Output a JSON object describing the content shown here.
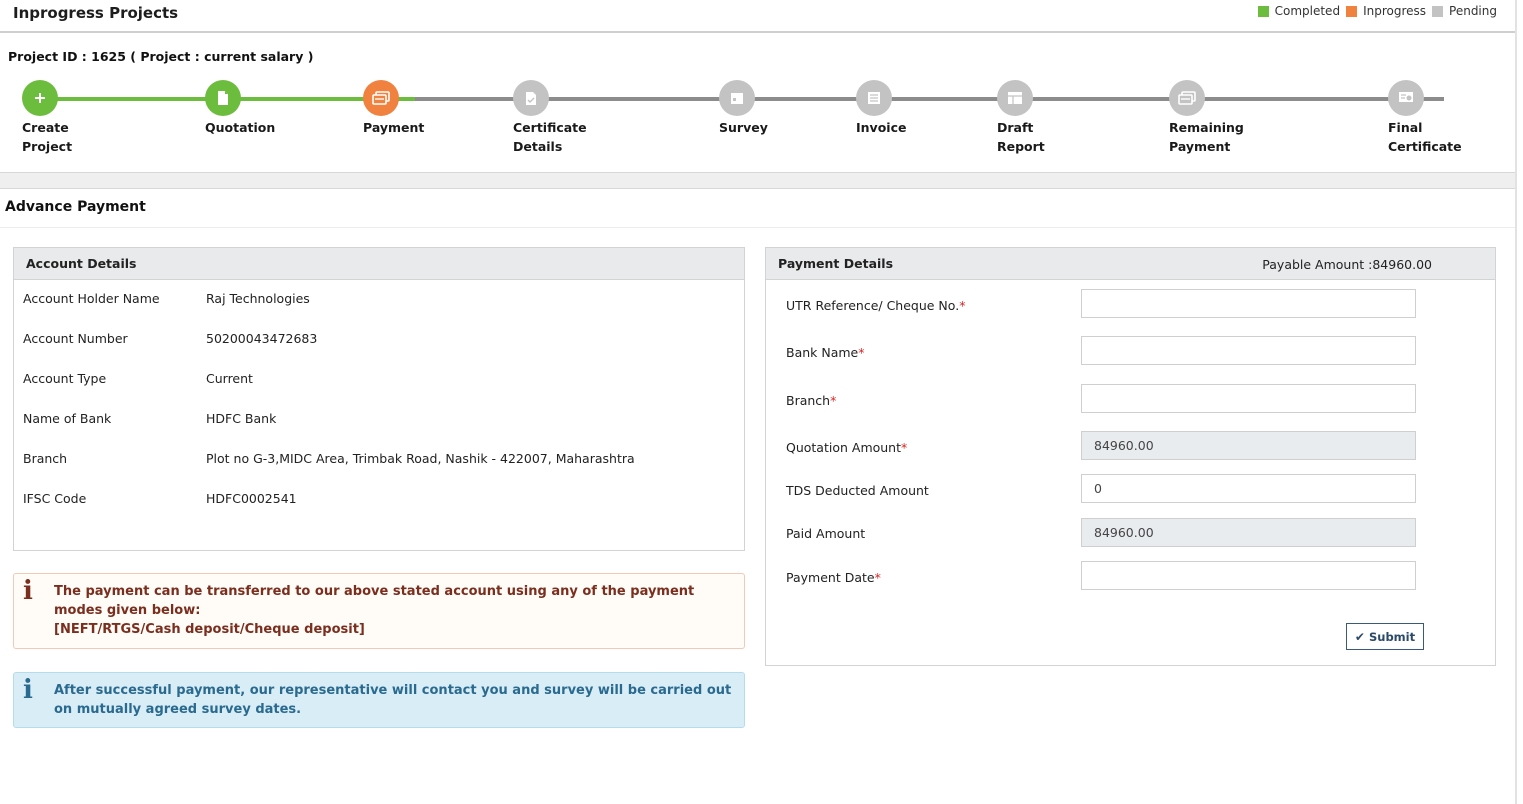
{
  "header": {
    "title": "Inprogress Projects"
  },
  "legend": [
    {
      "label": "Completed",
      "color": "#6cbd3e"
    },
    {
      "label": "Inprogress",
      "color": "#f0813e"
    },
    {
      "label": "Pending",
      "color": "#c3c3c3"
    }
  ],
  "project": {
    "id_line": "Project ID : 1625 ( Project : current salary )"
  },
  "steps": [
    {
      "line1": "Create",
      "line2": "Project",
      "status": "completed",
      "icon": "plus-icon"
    },
    {
      "line1": "Quotation",
      "line2": "",
      "status": "completed",
      "icon": "document-icon"
    },
    {
      "line1": "Payment",
      "line2": "",
      "status": "inprogress",
      "icon": "payment-icon"
    },
    {
      "line1": "Certificate",
      "line2": "Details",
      "status": "pending",
      "icon": "certificate-doc-icon"
    },
    {
      "line1": "Survey",
      "line2": "",
      "status": "pending",
      "icon": "calendar-icon"
    },
    {
      "line1": "Invoice",
      "line2": "",
      "status": "pending",
      "icon": "invoice-icon"
    },
    {
      "line1": "Draft",
      "line2": "Report",
      "status": "pending",
      "icon": "report-icon"
    },
    {
      "line1": "Remaining",
      "line2": "Payment",
      "status": "pending",
      "icon": "payment-icon"
    },
    {
      "line1": "Final",
      "line2": "Certificate",
      "status": "pending",
      "icon": "award-icon"
    }
  ],
  "section": {
    "title": "Advance Payment"
  },
  "account": {
    "title": "Account Details",
    "rows": [
      {
        "label": "Account Holder Name",
        "value": "Raj Technologies"
      },
      {
        "label": "Account Number",
        "value": "50200043472683"
      },
      {
        "label": "Account Type",
        "value": "Current"
      },
      {
        "label": "Name of Bank",
        "value": "HDFC Bank"
      },
      {
        "label": "Branch",
        "value": "Plot no G-3,MIDC Area, Trimbak Road, Nashik - 422007, Maharashtra"
      },
      {
        "label": "IFSC Code",
        "value": "HDFC0002541"
      }
    ]
  },
  "alerts": {
    "warning": {
      "line1": "The payment can be transferred to our above stated account using any of the payment",
      "line2": "modes given below:",
      "line3": "[NEFT/RTGS/Cash deposit/Cheque deposit]"
    },
    "info": {
      "line1": "After successful payment, our representative will contact you and survey will be carried out",
      "line2": "on mutually agreed survey dates."
    }
  },
  "payment": {
    "title": "Payment Details",
    "payable": "Payable Amount :84960.00",
    "fields": [
      {
        "label": "UTR Reference/ Cheque No.",
        "required": "*",
        "value": ""
      },
      {
        "label": "Bank Name",
        "required": "*",
        "value": ""
      },
      {
        "label": "Branch",
        "required": "*",
        "value": ""
      },
      {
        "label": "Quotation Amount",
        "required": "*",
        "value": "84960.00"
      },
      {
        "label": "TDS Deducted Amount",
        "required": "",
        "value": "0"
      },
      {
        "label": "Paid Amount",
        "required": "",
        "value": "84960.00"
      },
      {
        "label": "Payment Date",
        "required": "*",
        "value": ""
      }
    ],
    "submit_label": "Submit"
  }
}
